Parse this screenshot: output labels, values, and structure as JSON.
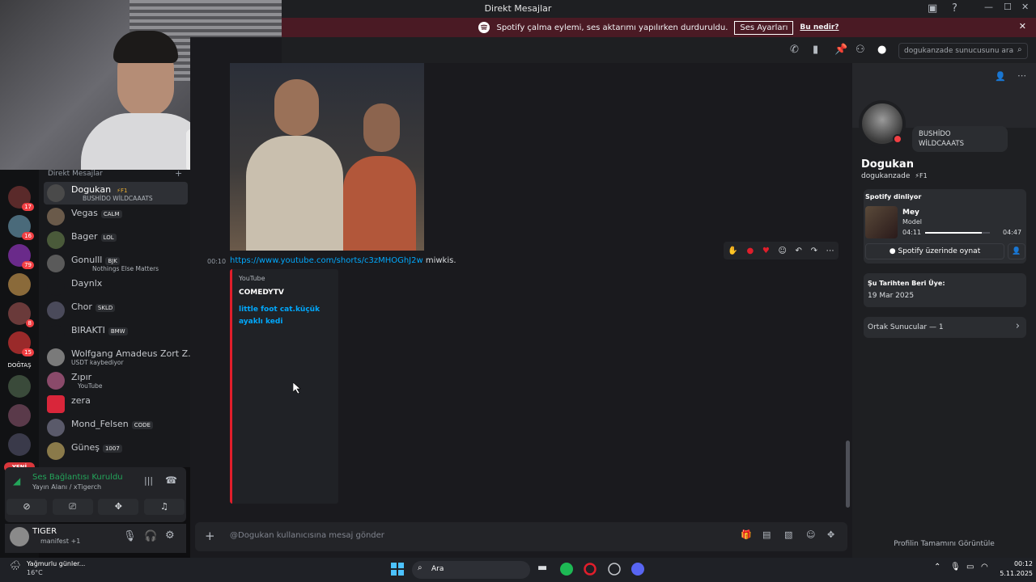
{
  "window": {
    "title": "Direkt Mesajlar"
  },
  "banner": {
    "text": "Spotify çalma eylemi, ses aktarımı yapılırken durduruldu.",
    "button": "Ses Ayarları",
    "link": "Bu nedir?"
  },
  "search": {
    "placeholder": "dogukanzade sunucusunu ara"
  },
  "dm_header": "Direkt Mesajlar",
  "dms": [
    {
      "name": "Dogukan",
      "tag": "⚡F1",
      "sub": "BUSHİDO WİLDCAAATS"
    },
    {
      "name": "Vegas",
      "tag": "CALM",
      "sub": ""
    },
    {
      "name": "Bager",
      "tag": "LOL",
      "sub": ""
    },
    {
      "name": "Gonulll",
      "tag": "BJK",
      "sub": "Nothings Else Matters"
    },
    {
      "name": "Daynlx",
      "tag": "",
      "sub": ""
    },
    {
      "name": "Chor",
      "tag": "SKLD",
      "sub": ""
    },
    {
      "name": "BIRAKTI",
      "tag": "BMW",
      "sub": ""
    },
    {
      "name": "Wolfgang Amadeus Zort Z...",
      "tag": "",
      "sub": "USDT kaybediyor"
    },
    {
      "name": "Zıpır",
      "tag": "",
      "sub": "YouTube"
    },
    {
      "name": "zera",
      "tag": "",
      "sub": ""
    },
    {
      "name": "Mond_Felsen",
      "tag": "CODE",
      "sub": ""
    },
    {
      "name": "Güneş",
      "tag": "1007",
      "sub": ""
    }
  ],
  "server_badges": [
    "17",
    "16",
    "79",
    "8",
    "15"
  ],
  "server_labels": {
    "dogtas": "DOĞTAŞ",
    "new": "YENİ"
  },
  "voice": {
    "status": "Ses Bağlantısı Kuruldu",
    "sub": "Yayın Alanı / xTigerch"
  },
  "user": {
    "name": "TIGER",
    "status": "manifest +1"
  },
  "message": {
    "time": "00:10",
    "link": "https://www.youtube.com/shorts/c3zMHOGhJ2w",
    "text": " miwkis."
  },
  "embed": {
    "provider": "YouTube",
    "author": "COMEDYTV",
    "title": "little foot cat.küçük ayaklı kedi"
  },
  "composer": {
    "placeholder": "@Dogukan kullanıcısına mesaj gönder"
  },
  "profile": {
    "status_text": "BUSHİDO WİLDCAAATS",
    "display_name": "Dogukan",
    "username": "dogukanzade",
    "tag": "⚡F1",
    "spotify_label": "Spotify dinliyor",
    "track": "Mey",
    "artist": "Model",
    "elapsed": "04:11",
    "duration": "04:47",
    "progress": 0.876,
    "play_button": "Spotify üzerinde oynat",
    "member_since_label": "Şu Tarihten Beri Üye:",
    "member_since": "19 Mar 2025",
    "mutual_servers": "Ortak Sunucular — 1",
    "view_full": "Profilin Tamamını Görüntüle"
  },
  "taskbar": {
    "weather": "Yağmurlu günler...",
    "temp": "16°C",
    "search": "Ara",
    "time": "00:12",
    "date": "5.11.2025"
  },
  "colors": {
    "accent": "#5865f2",
    "red": "#e01e2b",
    "green": "#23a55a",
    "link": "#00a8fc"
  }
}
